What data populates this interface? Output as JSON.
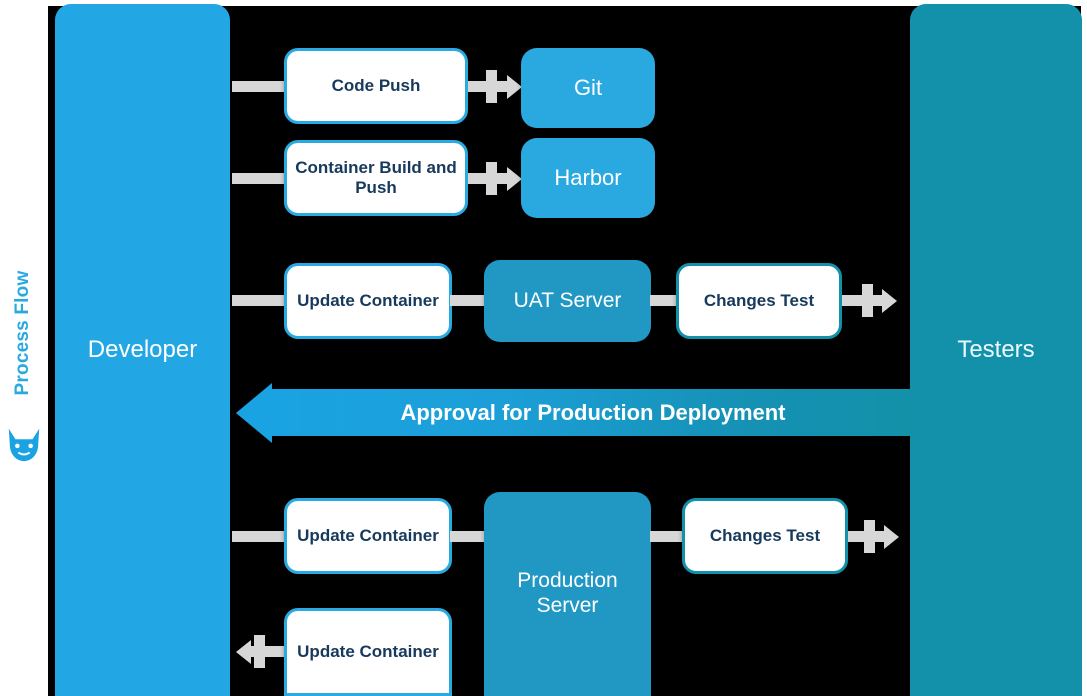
{
  "diagram": {
    "title": "Process Flow",
    "logo_icon": "fox-head-logo-icon",
    "lanes": [
      {
        "id": "developer",
        "label": "Developer",
        "color": "#22a7e4"
      },
      {
        "id": "testers",
        "label": "Testers",
        "color": "#1491aa"
      }
    ],
    "nodes": [
      {
        "id": "code-push",
        "label": "Code Push",
        "style": "white-blue"
      },
      {
        "id": "git",
        "label": "Git",
        "style": "fill-blue"
      },
      {
        "id": "container-build",
        "label": "Container Build and Push",
        "style": "white-blue"
      },
      {
        "id": "harbor",
        "label": "Harbor",
        "style": "fill-blue"
      },
      {
        "id": "update-container-1",
        "label": "Update Container",
        "style": "white-blue"
      },
      {
        "id": "uat-server",
        "label": "UAT Server",
        "style": "fill-teal"
      },
      {
        "id": "changes-test-1",
        "label": "Changes Test",
        "style": "white-teal"
      },
      {
        "id": "update-container-2",
        "label": "Update Container",
        "style": "white-blue"
      },
      {
        "id": "production-server",
        "label": "Production Server",
        "style": "fill-teal"
      },
      {
        "id": "changes-test-2",
        "label": "Changes Test",
        "style": "white-teal"
      },
      {
        "id": "update-container-3",
        "label": "Update Container",
        "style": "white-blue"
      }
    ],
    "banner": {
      "label": "Approval for Production Deployment",
      "direction": "left",
      "color_start": "#1391a8",
      "color_end": "#1aa3e2"
    },
    "colors": {
      "blue": "#29abe2",
      "teal": "#1491aa",
      "text_dark": "#17395c",
      "connector": "#d7d7d7",
      "background": "#000000"
    }
  }
}
